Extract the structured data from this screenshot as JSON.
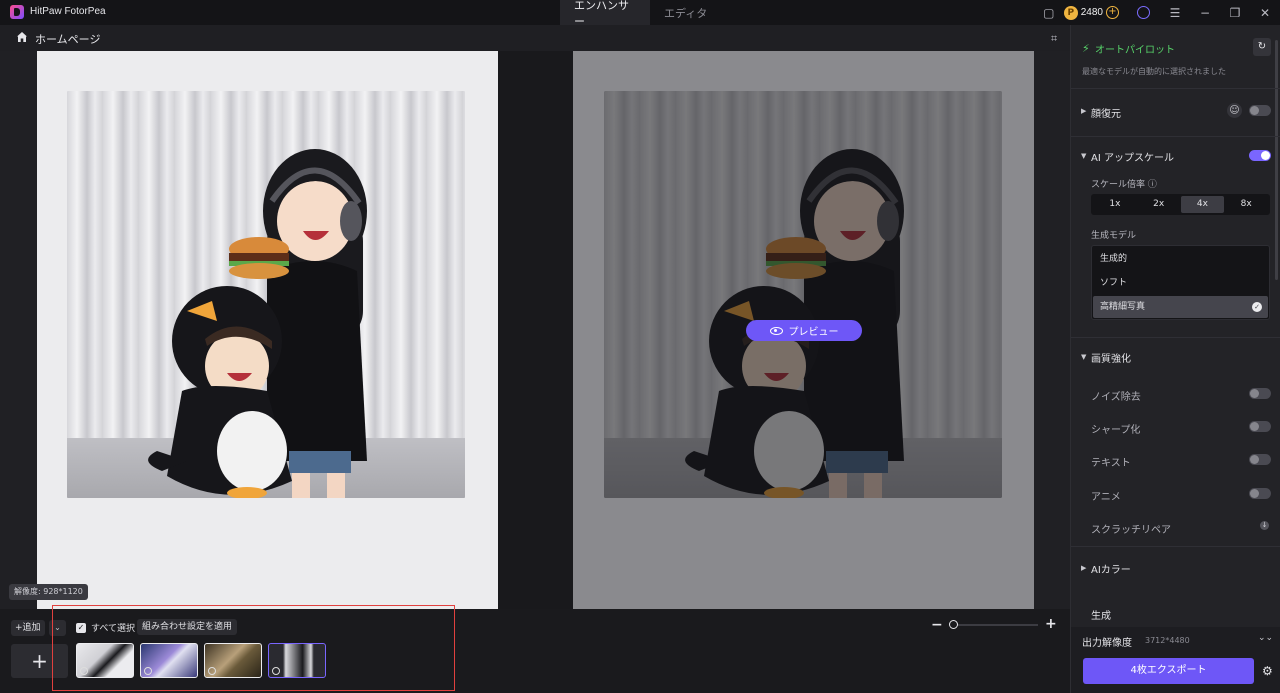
{
  "app": {
    "title": "HitPaw FotorPea"
  },
  "tabs": [
    {
      "label": "エンハンサー",
      "active": true
    },
    {
      "label": "エディタ",
      "active": false
    }
  ],
  "account": {
    "coins": "2480"
  },
  "nav": {
    "home_label": "ホームページ"
  },
  "canvas": {
    "resolution_badge": "解像度: 928*1120",
    "preview_label": "プレビュー"
  },
  "batch": {
    "add_label": "+追加",
    "select_all_label": "すべて選択",
    "apply_label": "組み合わせ設定を適用",
    "add_tile_symbol": "+",
    "thumbnails": [
      {
        "name": "thumb-1"
      },
      {
        "name": "thumb-2"
      },
      {
        "name": "thumb-3"
      },
      {
        "name": "thumb-4",
        "active": true
      }
    ]
  },
  "zoom": {
    "minus": "−",
    "plus": "+",
    "level": 0
  },
  "panel": {
    "autopilot": {
      "title": "オートパイロット",
      "subtitle": "最適なモデルが自動的に選択されました"
    },
    "face_restore": {
      "title": "顔復元",
      "enabled": false
    },
    "upscale": {
      "title": "AI アップスケール",
      "enabled": true,
      "scale_label": "スケール倍率 ⓘ",
      "scales": [
        "1x",
        "2x",
        "4x",
        "8x"
      ],
      "selected_scale": "4x",
      "model_label": "生成モデル",
      "models": [
        "生成的",
        "ソフト",
        "高精細写真"
      ],
      "selected_model": "高精細写真"
    },
    "quality": {
      "title": "画質強化",
      "options": [
        {
          "label": "ノイズ除去",
          "enabled": false
        },
        {
          "label": "シャープ化",
          "enabled": false
        },
        {
          "label": "テキスト",
          "enabled": false
        },
        {
          "label": "アニメ",
          "enabled": false
        },
        {
          "label": "スクラッチリペア"
        }
      ]
    },
    "color": {
      "title": "AIカラー",
      "item": "生成"
    },
    "output": {
      "label": "出力解像度",
      "value": "3712*4480"
    },
    "export_label": "4枚エクスポート"
  },
  "colors": {
    "accent": "#6e57f7",
    "autopilot_green": "#57d36a",
    "highlight_frame": "#e0403e"
  }
}
